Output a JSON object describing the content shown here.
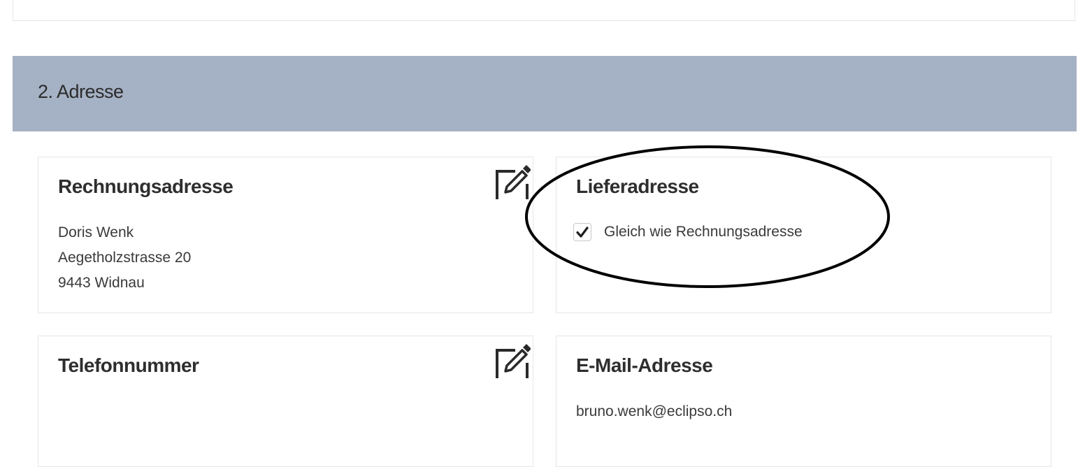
{
  "section": {
    "title": "2. Adresse"
  },
  "billing": {
    "title": "Rechnungsadresse",
    "lines": [
      "Doris Wenk",
      "Aegetholzstrasse 20",
      "9443 Widnau"
    ],
    "edit_icon": "edit-icon"
  },
  "shipping": {
    "title": "Lieferadresse",
    "checkbox_label": "Gleich wie Rechnungsadresse",
    "checkbox_checked": true
  },
  "phone": {
    "title": "Telefonnummer",
    "edit_icon": "edit-icon"
  },
  "email": {
    "title": "E-Mail-Adresse",
    "value": "bruno.wenk@eclipso.ch"
  },
  "colors": {
    "header_bg": "#a5b1c4",
    "card_border": "#e6e6e6",
    "text": "#333333"
  }
}
